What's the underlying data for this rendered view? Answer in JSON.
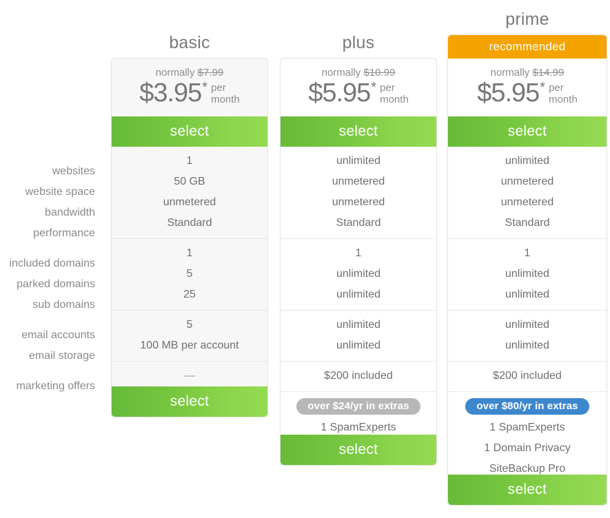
{
  "feature_labels": {
    "groups": [
      [
        "websites",
        "website space",
        "bandwidth",
        "performance"
      ],
      [
        "included domains",
        "parked domains",
        "sub domains"
      ],
      [
        "email accounts",
        "email storage"
      ],
      [
        "marketing offers"
      ]
    ]
  },
  "select_label": "select",
  "plans": {
    "basic": {
      "title": "basic",
      "normally_prefix": "normally",
      "normally_price": "$7.99",
      "price": "$3.95",
      "price_star": "*",
      "per_line1": "per",
      "per_line2": "month",
      "features": [
        [
          "1",
          "50 GB",
          "unmetered",
          "Standard"
        ],
        [
          "1",
          "5",
          "25"
        ],
        [
          "5",
          "100 MB per account"
        ],
        [
          "—"
        ]
      ]
    },
    "plus": {
      "title": "plus",
      "normally_prefix": "normally",
      "normally_price": "$10.99",
      "price": "$5.95",
      "price_star": "*",
      "per_line1": "per",
      "per_line2": "month",
      "features": [
        [
          "unlimited",
          "unmetered",
          "unmetered",
          "Standard"
        ],
        [
          "1",
          "unlimited",
          "unlimited"
        ],
        [
          "unlimited",
          "unlimited"
        ],
        [
          "$200 included"
        ]
      ],
      "extras_badge": "over $24/yr in extras",
      "extras_badge_color": "#b7b7b7",
      "bonuses": [
        "1 SpamExperts"
      ]
    },
    "prime": {
      "title": "prime",
      "recommended_label": "recommended",
      "recommended_color": "#f5a300",
      "normally_prefix": "normally",
      "normally_price": "$14.99",
      "price": "$5.95",
      "price_star": "*",
      "per_line1": "per",
      "per_line2": "month",
      "features": [
        [
          "unlimited",
          "unmetered",
          "unmetered",
          "Standard"
        ],
        [
          "1",
          "unlimited",
          "unlimited"
        ],
        [
          "unlimited",
          "unlimited"
        ],
        [
          "$200 included"
        ]
      ],
      "extras_badge": "over $80/yr in extras",
      "extras_badge_color": "#3d87cd",
      "bonuses": [
        "1 SpamExperts",
        "1 Domain Privacy",
        "SiteBackup Pro"
      ]
    }
  },
  "colors": {
    "select_green_dark": "#67bb38",
    "select_green_light": "#94da52",
    "orange": "#f5a300",
    "blue": "#3d87cd",
    "gray_badge": "#b7b7b7",
    "card_basic_bg": "#f7f7f7"
  }
}
